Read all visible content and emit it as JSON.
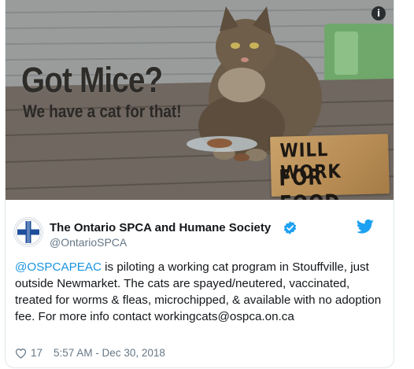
{
  "media": {
    "headline": "Got Mice?",
    "subline": "We have a cat for that!",
    "sign_line1": "WILL WORK",
    "sign_line2": "FOR FOOD",
    "info_icon": "info-icon"
  },
  "author": {
    "name": "The Ontario SPCA and Humane Society",
    "handle": "@OntarioSPCA",
    "verified_icon": "verified-badge-icon",
    "platform_icon": "twitter-bird-icon"
  },
  "tweet": {
    "mention": "@OSPCAPEAC",
    "text_rest": " is piloting a working cat program in Stouffville, just outside Newmarket. The cats are spayed/neutered, vaccinated, treated for worms & fleas, microchipped, & available with no adoption fee. For more info contact workingcats@ospca.on.ca"
  },
  "footer": {
    "likes": "17",
    "timestamp": "5:57 AM - Dec 30, 2018",
    "like_icon": "heart-icon"
  },
  "colors": {
    "link": "#1b95e0",
    "muted": "#657786",
    "verified": "#1da1f2",
    "avatar_cross": "#1d4e9b"
  }
}
